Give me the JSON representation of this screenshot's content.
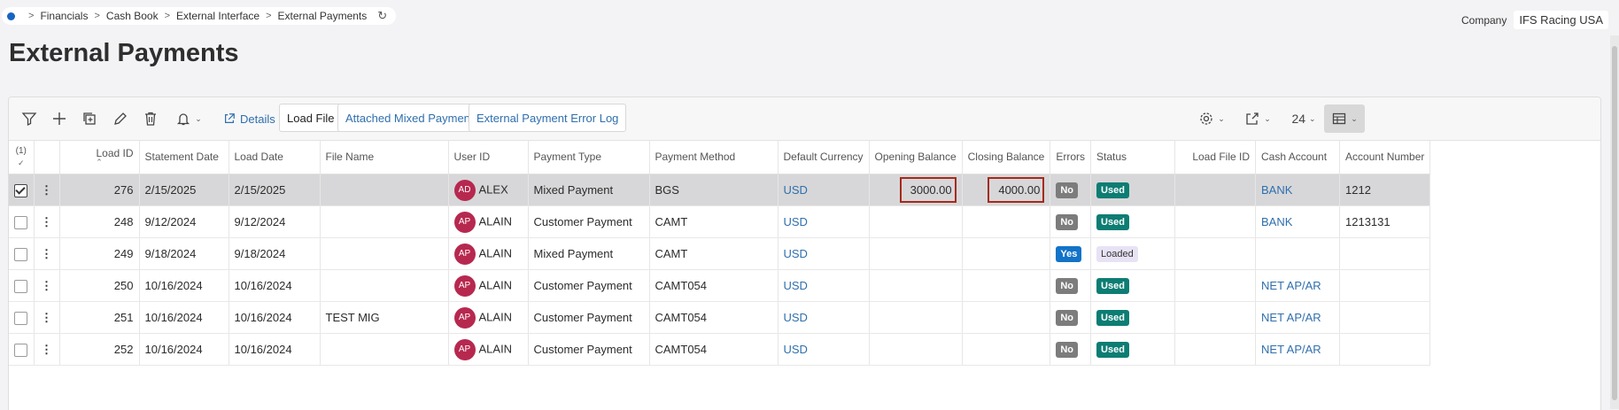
{
  "breadcrumb": {
    "items": [
      "Financials",
      "Cash Book",
      "External Interface",
      "External Payments"
    ]
  },
  "company": {
    "label": "Company",
    "value": "IFS Racing USA"
  },
  "page_title": "External Payments",
  "toolbar": {
    "details_label": "Details",
    "load_file_label": "Load File",
    "attached_mixed_label": "Attached Mixed Payment",
    "error_log_label": "External Payment Error Log",
    "page_size": "24"
  },
  "grid": {
    "selected_count": "(1)",
    "columns": [
      "Load ID",
      "Statement Date",
      "Load Date",
      "File Name",
      "User ID",
      "Payment Type",
      "Payment Method",
      "Default Currency",
      "Opening Balance",
      "Closing Balance",
      "Errors",
      "Status",
      "Load File ID",
      "Cash Account",
      "Account Number"
    ],
    "rows": [
      {
        "selected": true,
        "load_id": "276",
        "statement_date": "2/15/2025",
        "load_date": "2/15/2025",
        "file_name": "",
        "user_initials": "AD",
        "user_id": "ALEX",
        "payment_type": "Mixed Payment",
        "payment_method": "BGS",
        "currency": "USD",
        "opening": "3000.00",
        "closing": "4000.00",
        "errors": "No",
        "status": "Used",
        "load_file_id": "",
        "cash_account": "BANK",
        "account_number": "1212"
      },
      {
        "selected": false,
        "load_id": "248",
        "statement_date": "9/12/2024",
        "load_date": "9/12/2024",
        "file_name": "",
        "user_initials": "AP",
        "user_id": "ALAIN",
        "payment_type": "Customer Payment",
        "payment_method": "CAMT",
        "currency": "USD",
        "opening": "",
        "closing": "",
        "errors": "No",
        "status": "Used",
        "load_file_id": "",
        "cash_account": "BANK",
        "account_number": "1213131"
      },
      {
        "selected": false,
        "load_id": "249",
        "statement_date": "9/18/2024",
        "load_date": "9/18/2024",
        "file_name": "",
        "user_initials": "AP",
        "user_id": "ALAIN",
        "payment_type": "Mixed Payment",
        "payment_method": "CAMT",
        "currency": "USD",
        "opening": "",
        "closing": "",
        "errors": "Yes",
        "status": "Loaded",
        "load_file_id": "",
        "cash_account": "",
        "account_number": ""
      },
      {
        "selected": false,
        "load_id": "250",
        "statement_date": "10/16/2024",
        "load_date": "10/16/2024",
        "file_name": "",
        "user_initials": "AP",
        "user_id": "ALAIN",
        "payment_type": "Customer Payment",
        "payment_method": "CAMT054",
        "currency": "USD",
        "opening": "",
        "closing": "",
        "errors": "No",
        "status": "Used",
        "load_file_id": "",
        "cash_account": "NET AP/AR",
        "account_number": ""
      },
      {
        "selected": false,
        "load_id": "251",
        "statement_date": "10/16/2024",
        "load_date": "10/16/2024",
        "file_name": "TEST MIG",
        "user_initials": "AP",
        "user_id": "ALAIN",
        "payment_type": "Customer Payment",
        "payment_method": "CAMT054",
        "currency": "USD",
        "opening": "",
        "closing": "",
        "errors": "No",
        "status": "Used",
        "load_file_id": "",
        "cash_account": "NET AP/AR",
        "account_number": ""
      },
      {
        "selected": false,
        "load_id": "252",
        "statement_date": "10/16/2024",
        "load_date": "10/16/2024",
        "file_name": "",
        "user_initials": "AP",
        "user_id": "ALAIN",
        "payment_type": "Customer Payment",
        "payment_method": "CAMT054",
        "currency": "USD",
        "opening": "",
        "closing": "",
        "errors": "No",
        "status": "Used",
        "load_file_id": "",
        "cash_account": "NET AP/AR",
        "account_number": ""
      }
    ]
  },
  "colors": {
    "accent": "#2f6fad",
    "used": "#0d7d73",
    "yes": "#1273c8",
    "no": "#7c7c7c",
    "avatar": "#b7284f",
    "highlight": "#a52a1a"
  }
}
